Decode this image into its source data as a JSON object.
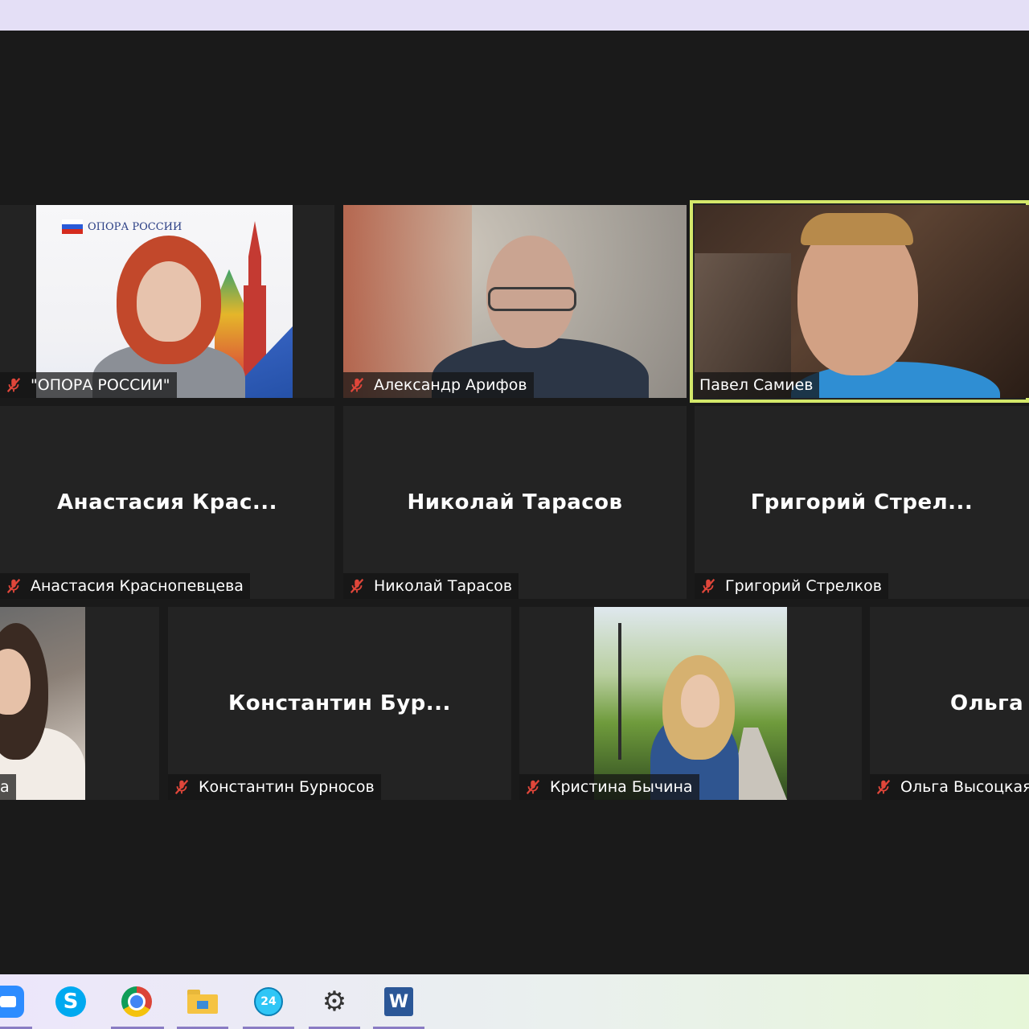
{
  "participants": [
    {
      "id": "opora",
      "label": "\"ОПОРА РОССИИ\"",
      "muted": true,
      "video": true,
      "logo_text": "ОПОРА РОССИИ"
    },
    {
      "id": "arifov",
      "label": "Александр Арифов",
      "muted": true,
      "video": true
    },
    {
      "id": "samiev",
      "label": "Павел Самиев",
      "muted": false,
      "video": true,
      "speaking": true
    },
    {
      "id": "krasnopevtseva",
      "label": "Анастасия Краснопевцева",
      "center": "Анастасия  Крас...",
      "muted": true,
      "video": false
    },
    {
      "id": "tarasov",
      "label": "Николай Тарасов",
      "center": "Николай Тарасов",
      "muted": true,
      "video": false
    },
    {
      "id": "strelkov",
      "label": "Григорий Стрелков",
      "center": "Григорий  Стрел...",
      "muted": true,
      "video": false
    },
    {
      "id": "left3",
      "label": "а",
      "muted": false,
      "video": true
    },
    {
      "id": "burnosov",
      "label": "Константин Бурносов",
      "center": "Константин  Бур...",
      "muted": true,
      "video": false
    },
    {
      "id": "bychina",
      "label": "Кристина Бычина",
      "muted": true,
      "video": true
    },
    {
      "id": "vysotskaya",
      "label": "Ольга Высоцкая",
      "center": "Ольга В",
      "muted": true,
      "video": false
    }
  ],
  "taskbar": {
    "apps": [
      "zoom-icon",
      "skype-icon",
      "chrome-icon",
      "file-explorer-icon",
      "bitrix24-icon",
      "settings-icon",
      "word-icon"
    ],
    "bitrix_badge": "24",
    "word_letter": "W"
  },
  "colors": {
    "speaker_border": "#d4e86a",
    "mic_muted": "#e0463a",
    "tile_bg": "#232323"
  }
}
